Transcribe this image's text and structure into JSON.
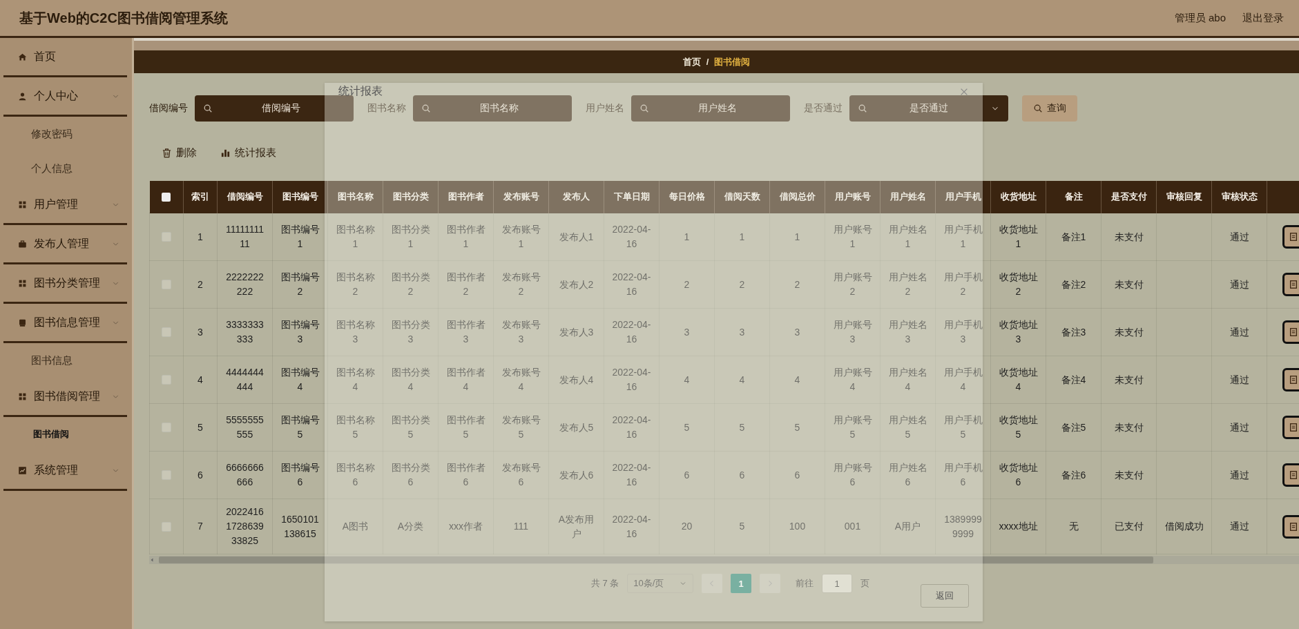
{
  "header": {
    "title": "基于Web的C2C图书借阅管理系统",
    "user": "管理员 abo",
    "logout": "退出登录"
  },
  "sidebar": {
    "items": [
      {
        "label": "首页",
        "kind": "link"
      },
      {
        "label": "个人中心",
        "kind": "submenu",
        "children": [
          {
            "label": "修改密码",
            "selected": false
          },
          {
            "label": "个人信息",
            "selected": false
          }
        ]
      },
      {
        "label": "用户管理",
        "kind": "submenu"
      },
      {
        "label": "发布人管理",
        "kind": "submenu"
      },
      {
        "label": "图书分类管理",
        "kind": "submenu"
      },
      {
        "label": "图书信息管理",
        "kind": "submenu",
        "children": [
          {
            "label": "图书信息",
            "selected": false
          }
        ]
      },
      {
        "label": "图书借阅管理",
        "kind": "submenu",
        "children": [
          {
            "label": "图书借阅",
            "selected": true
          }
        ]
      },
      {
        "label": "系统管理",
        "kind": "submenu"
      }
    ]
  },
  "breadcrumb": [
    "首页",
    "图书借阅"
  ],
  "breadcrumb_separator": "/",
  "search": {
    "fields": [
      {
        "label": "借阅编号",
        "placeholder": "借阅编号",
        "kind": "input"
      },
      {
        "label": "图书名称",
        "placeholder": "图书名称",
        "kind": "input"
      },
      {
        "label": "用户姓名",
        "placeholder": "用户姓名",
        "kind": "input"
      },
      {
        "label": "是否通过",
        "placeholder": "是否通过",
        "kind": "select"
      }
    ],
    "button": "查询"
  },
  "actions": [
    {
      "label": "删除"
    },
    {
      "label": "统计报表"
    }
  ],
  "table": {
    "header_checked": false,
    "columns": [
      "索引",
      "借阅编号",
      "图书编号",
      "图书名称",
      "图书分类",
      "图书作者",
      "发布账号",
      "发布人",
      "下单日期",
      "每日价格",
      "借阅天数",
      "借阅总价",
      "用户账号",
      "用户姓名",
      "用户手机",
      "收货地址",
      "备注",
      "是否支付",
      "审核回复",
      "审核状态"
    ],
    "rows": [
      {
        "checked": false,
        "cells": [
          "1",
          "1111111111",
          "图书编号1",
          "图书名称1",
          "图书分类1",
          "图书作者1",
          "发布账号1",
          "发布人1",
          "2022-04-16",
          "1",
          "1",
          "1",
          "用户账号1",
          "用户姓名1",
          "用户手机1",
          "收货地址1",
          "备注1",
          "未支付",
          null,
          "通过"
        ]
      },
      {
        "checked": false,
        "cells": [
          "2",
          "2222222222",
          "图书编号2",
          "图书名称2",
          "图书分类2",
          "图书作者2",
          "发布账号2",
          "发布人2",
          "2022-04-16",
          "2",
          "2",
          "2",
          "用户账号2",
          "用户姓名2",
          "用户手机2",
          "收货地址2",
          "备注2",
          "未支付",
          null,
          "通过"
        ]
      },
      {
        "checked": false,
        "cells": [
          "3",
          "3333333333",
          "图书编号3",
          "图书名称3",
          "图书分类3",
          "图书作者3",
          "发布账号3",
          "发布人3",
          "2022-04-16",
          "3",
          "3",
          "3",
          "用户账号3",
          "用户姓名3",
          "用户手机3",
          "收货地址3",
          "备注3",
          "未支付",
          null,
          "通过"
        ]
      },
      {
        "checked": false,
        "cells": [
          "4",
          "4444444444",
          "图书编号4",
          "图书名称4",
          "图书分类4",
          "图书作者4",
          "发布账号4",
          "发布人4",
          "2022-04-16",
          "4",
          "4",
          "4",
          "用户账号4",
          "用户姓名4",
          "用户手机4",
          "收货地址4",
          "备注4",
          "未支付",
          null,
          "通过"
        ]
      },
      {
        "checked": false,
        "cells": [
          "5",
          "5555555555",
          "图书编号5",
          "图书名称5",
          "图书分类5",
          "图书作者5",
          "发布账号5",
          "发布人5",
          "2022-04-16",
          "5",
          "5",
          "5",
          "用户账号5",
          "用户姓名5",
          "用户手机5",
          "收货地址5",
          "备注5",
          "未支付",
          null,
          "通过"
        ]
      },
      {
        "checked": false,
        "cells": [
          "6",
          "6666666666",
          "图书编号6",
          "图书名称6",
          "图书分类6",
          "图书作者6",
          "发布账号6",
          "发布人6",
          "2022-04-16",
          "6",
          "6",
          "6",
          "用户账号6",
          "用户姓名6",
          "用户手机6",
          "收货地址6",
          "备注6",
          "未支付",
          null,
          "通过"
        ]
      },
      {
        "checked": false,
        "cells": [
          "7",
          "2022416172863933825",
          "1650101138615",
          "A图书",
          "A分类",
          "xxx作者",
          "111",
          "A发布用户",
          "2022-04-16",
          "20",
          "5",
          "100",
          "001",
          "A用户",
          "13899999999",
          "xxxx地址",
          "无",
          "已支付",
          "借阅成功",
          "通过"
        ]
      }
    ]
  },
  "pagination": {
    "total": "共 7 条",
    "page_size": "10条/页",
    "pages": [
      {
        "label": "1",
        "selected": true
      }
    ],
    "goto_label": "前往",
    "goto_value": "1",
    "page_unit": "页"
  },
  "dialog": {
    "title": "统计报表",
    "buttons": [
      "返回"
    ]
  }
}
